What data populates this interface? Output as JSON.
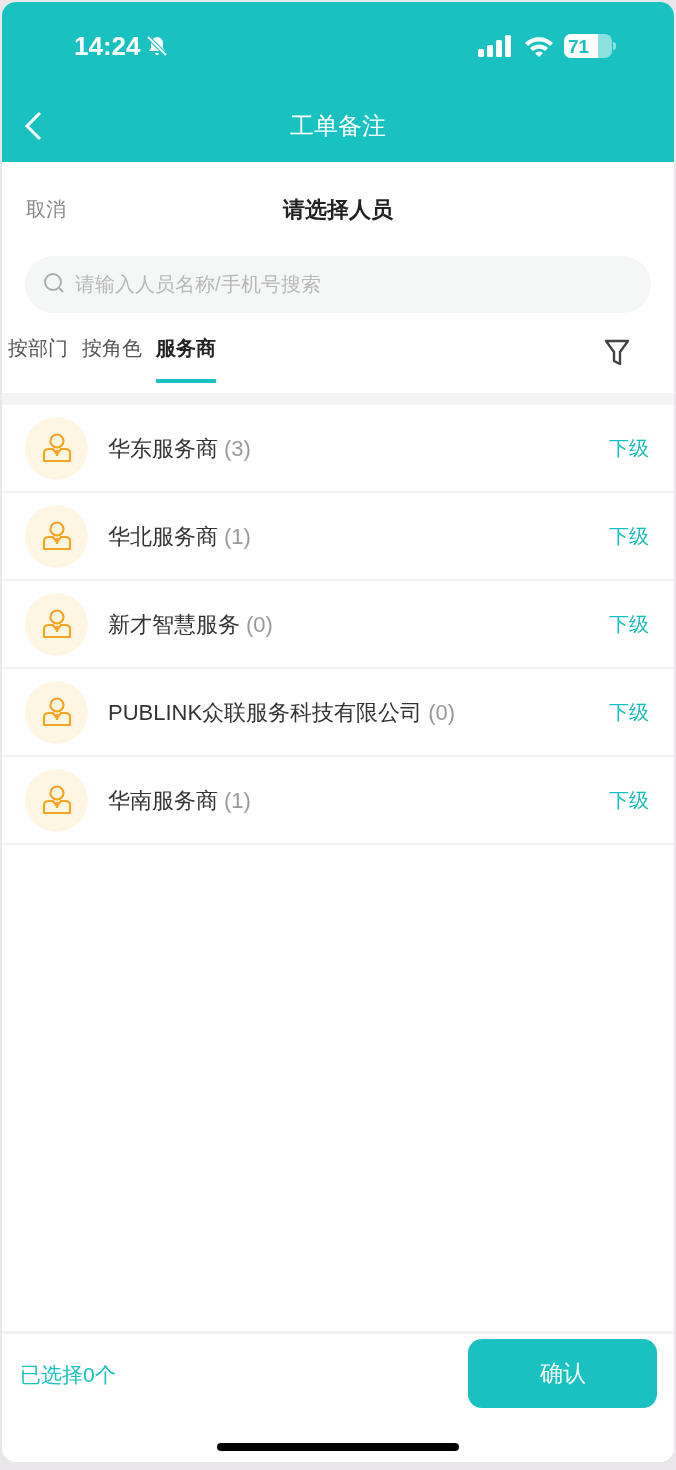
{
  "status_bar": {
    "time": "14:24",
    "battery": "71"
  },
  "nav_bar": {
    "title": "工单备注"
  },
  "sheet": {
    "cancel": "取消",
    "title": "请选择人员"
  },
  "search": {
    "placeholder": "请输入人员名称/手机号搜索"
  },
  "tabs": [
    {
      "label": "按部门",
      "selected": false
    },
    {
      "label": "按角色",
      "selected": false
    },
    {
      "label": "服务商",
      "selected": true
    }
  ],
  "providers": [
    {
      "name": "华东服务商",
      "count": "(3)",
      "action": "下级"
    },
    {
      "name": "华北服务商",
      "count": "(1)",
      "action": "下级"
    },
    {
      "name": "新才智慧服务",
      "count": "(0)",
      "action": "下级"
    },
    {
      "name": "PUBLINK众联服务科技有限公司",
      "count": "(0)",
      "action": "下级"
    },
    {
      "name": "华南服务商",
      "count": "(1)",
      "action": "下级"
    }
  ],
  "footer": {
    "selected_count": "已选择0个",
    "confirm": "确认"
  }
}
